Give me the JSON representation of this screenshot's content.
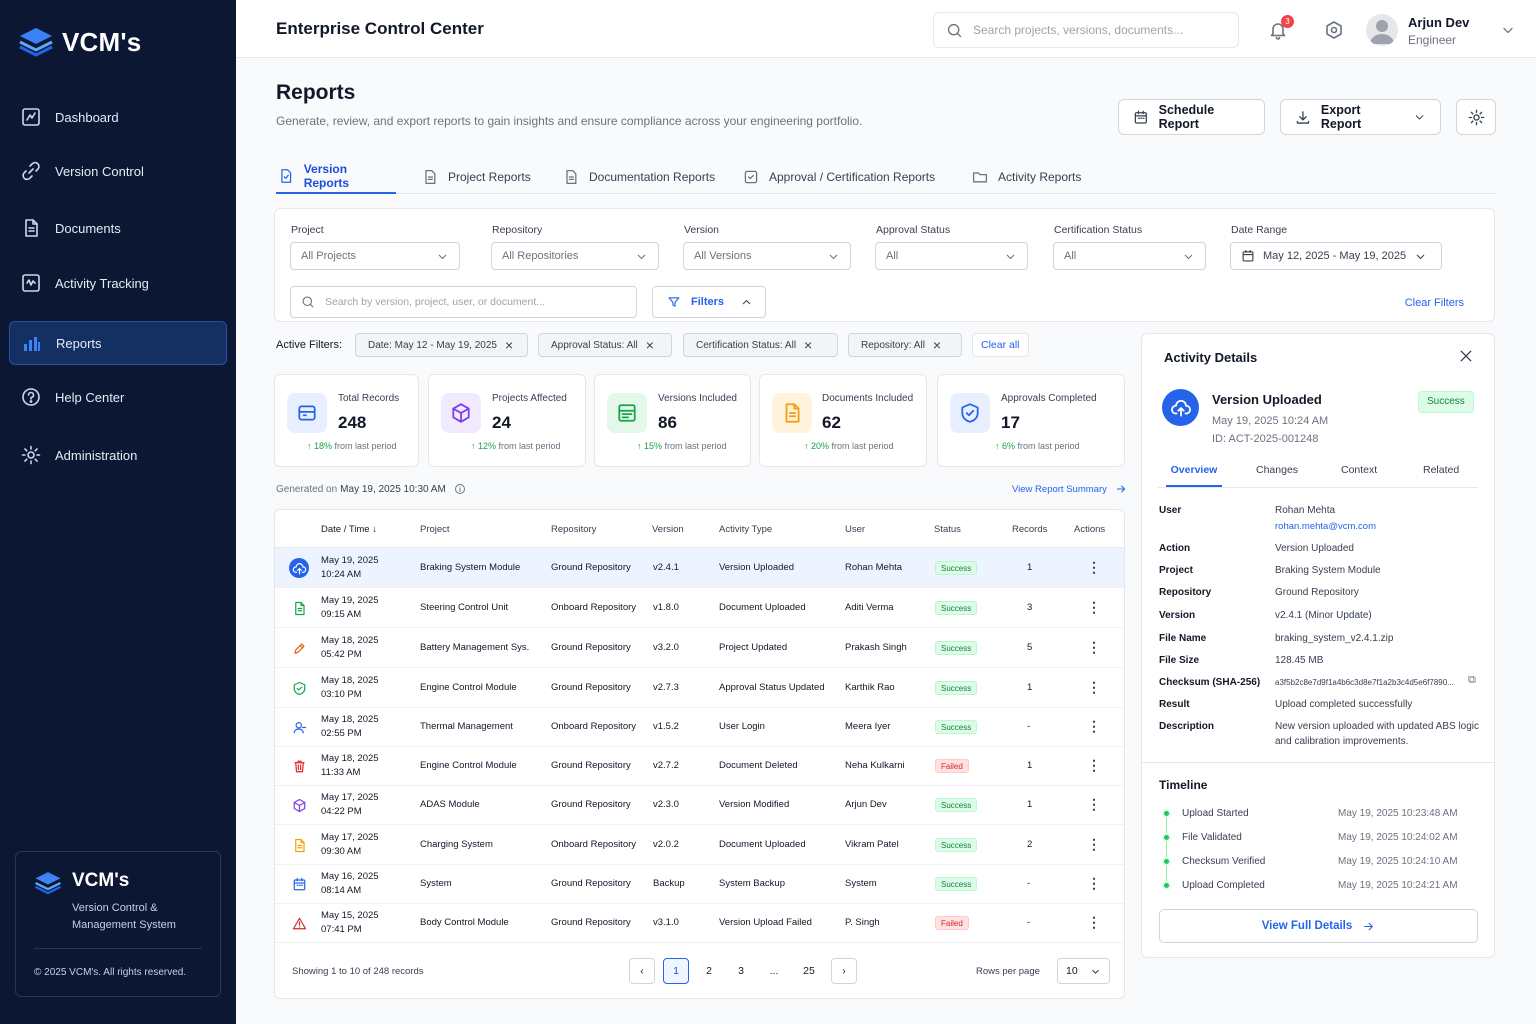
{
  "brand": {
    "logo_text": "VCM's",
    "card_title": "VCM's",
    "card_desc": "Version Control & Management System",
    "copyright": "© 2025 VCM's. All rights reserved."
  },
  "sidebar": {
    "items": [
      {
        "label": "Dashboard",
        "icon": "dashboard-icon"
      },
      {
        "label": "Version Control",
        "icon": "link-icon"
      },
      {
        "label": "Documents",
        "icon": "document-icon"
      },
      {
        "label": "Activity Tracking",
        "icon": "activity-icon"
      },
      {
        "label": "Reports",
        "icon": "bar-chart-icon",
        "active": true
      },
      {
        "label": "Help Center",
        "icon": "help-icon"
      },
      {
        "label": "Administration",
        "icon": "gear-icon"
      }
    ]
  },
  "header": {
    "title": "Enterprise Control Center",
    "search_placeholder": "Search projects, versions, documents...",
    "notif_count": "3",
    "user_name": "Arjun Dev",
    "user_role": "Engineer"
  },
  "page": {
    "title": "Reports",
    "subtitle": "Generate, review, and export reports to gain insights and ensure compliance across your engineering portfolio.",
    "schedule_label": "Schedule Report",
    "export_label": "Export Report"
  },
  "tabs": [
    "Version Reports",
    "Project Reports",
    "Documentation Reports",
    "Approval / Certification Reports",
    "Activity Reports"
  ],
  "filters": {
    "project": {
      "label": "Project",
      "value": "All Projects"
    },
    "repository": {
      "label": "Repository",
      "value": "All Repositories"
    },
    "version": {
      "label": "Version",
      "value": "All Versions"
    },
    "approval": {
      "label": "Approval Status",
      "value": "All"
    },
    "certification": {
      "label": "Certification Status",
      "value": "All"
    },
    "date": {
      "label": "Date Range",
      "value": "May 12, 2025 - May 19, 2025"
    },
    "search_placeholder": "Search by version, project, user, or document...",
    "filters_label": "Filters",
    "clear_label": "Clear Filters"
  },
  "active_filters": {
    "label": "Active Filters:",
    "chips": [
      "Date: May 12 - May 19, 2025",
      "Approval Status: All",
      "Certification Status: All",
      "Repository: All"
    ],
    "clear_all": "Clear all"
  },
  "stats": [
    {
      "label": "Total Records",
      "value": "248",
      "trend": "↑ 18%",
      "trend_text": "from last period",
      "color": "#2563eb",
      "bg": "#e8efff"
    },
    {
      "label": "Projects Affected",
      "value": "24",
      "trend": "↑ 12%",
      "trend_text": "from last period",
      "color": "#7c3aed",
      "bg": "#f1eafe"
    },
    {
      "label": "Versions Included",
      "value": "86",
      "trend": "↑ 15%",
      "trend_text": "from last period",
      "color": "#16a34a",
      "bg": "#e3f7ea"
    },
    {
      "label": "Documents Included",
      "value": "62",
      "trend": "↑ 20%",
      "trend_text": "from last period",
      "color": "#f59e0b",
      "bg": "#fff3dc"
    },
    {
      "label": "Approvals Completed",
      "value": "17",
      "trend": "↑ 6%",
      "trend_text": "from last period",
      "color": "#2563eb",
      "bg": "#e8efff"
    }
  ],
  "generated": {
    "prefix": "Generated on",
    "value": "May 19, 2025 10:30 AM",
    "summary_link": "View Report Summary"
  },
  "table": {
    "columns": [
      "Date / Time",
      "Project",
      "Repository",
      "Version",
      "Activity Type",
      "User",
      "Status",
      "Records",
      "Actions"
    ],
    "rows": [
      {
        "date": "May 19, 2025",
        "time": "10:24 AM",
        "project": "Braking System Module",
        "repo": "Ground Repository",
        "version": "v2.4.1",
        "activity": "Version Uploaded",
        "user": "Rohan Mehta",
        "status": "Success",
        "records": "1",
        "icon": "upload-cloud-icon",
        "color": "#2563eb"
      },
      {
        "date": "May 19, 2025",
        "time": "09:15 AM",
        "project": "Steering Control Unit",
        "repo": "Onboard Repository",
        "version": "v1.8.0",
        "activity": "Document Uploaded",
        "user": "Aditi Verma",
        "status": "Success",
        "records": "3",
        "icon": "document-icon",
        "color": "#16a34a"
      },
      {
        "date": "May 18, 2025",
        "time": "05:42 PM",
        "project": "Battery Management Sys.",
        "repo": "Ground Repository",
        "version": "v3.2.0",
        "activity": "Project Updated",
        "user": "Prakash Singh",
        "status": "Success",
        "records": "5",
        "icon": "pencil-icon",
        "color": "#ea580c"
      },
      {
        "date": "May 18, 2025",
        "time": "03:10 PM",
        "project": "Engine Control Module",
        "repo": "Ground Repository",
        "version": "v2.7.3",
        "activity": "Approval Status Updated",
        "user": "Karthik Rao",
        "status": "Success",
        "records": "1",
        "icon": "shield-check-icon",
        "color": "#16a34a"
      },
      {
        "date": "May 18, 2025",
        "time": "02:55 PM",
        "project": "Thermal Management",
        "repo": "Onboard Repository",
        "version": "v1.5.2",
        "activity": "User Login",
        "user": "Meera Iyer",
        "status": "Success",
        "records": "-",
        "icon": "user-icon",
        "color": "#2563eb"
      },
      {
        "date": "May 18, 2025",
        "time": "11:33 AM",
        "project": "Engine Control Module",
        "repo": "Ground Repository",
        "version": "v2.7.2",
        "activity": "Document Deleted",
        "user": "Neha Kulkarni",
        "status": "Failed",
        "records": "1",
        "icon": "trash-icon",
        "color": "#dc2626"
      },
      {
        "date": "May 17, 2025",
        "time": "04:22 PM",
        "project": "ADAS Module",
        "repo": "Ground Repository",
        "version": "v2.3.0",
        "activity": "Version Modified",
        "user": "Arjun Dev",
        "status": "Success",
        "records": "1",
        "icon": "cube-icon",
        "color": "#7c3aed"
      },
      {
        "date": "May 17, 2025",
        "time": "09:30 AM",
        "project": "Charging System",
        "repo": "Onboard Repository",
        "version": "v2.0.2",
        "activity": "Document Uploaded",
        "user": "Vikram Patel",
        "status": "Success",
        "records": "2",
        "icon": "document-icon",
        "color": "#f59e0b"
      },
      {
        "date": "May 16, 2025",
        "time": "08:14 AM",
        "project": "System",
        "repo": "Ground Repository",
        "version": "Backup",
        "activity": "System Backup",
        "user": "System",
        "status": "Success",
        "records": "-",
        "icon": "calendar-icon",
        "color": "#2563eb"
      },
      {
        "date": "May 15, 2025",
        "time": "07:41 PM",
        "project": "Body Control Module",
        "repo": "Ground Repository",
        "version": "v3.1.0",
        "activity": "Version Upload Failed",
        "user": "P. Singh",
        "status": "Failed",
        "records": "-",
        "icon": "warning-icon",
        "color": "#dc2626"
      }
    ],
    "showing": "Showing 1 to 10 of 248 records",
    "pages": [
      "1",
      "2",
      "3",
      "...",
      "25"
    ],
    "rows_per_page_label": "Rows per page",
    "rows_per_page": "10"
  },
  "details": {
    "title": "Activity Details",
    "event": "Version Uploaded",
    "event_date": "May 19, 2025 10:24 AM",
    "event_id": "ID: ACT-2025-001248",
    "status": "Success",
    "tabs": [
      "Overview",
      "Changes",
      "Context",
      "Related"
    ],
    "user": {
      "label": "User",
      "name": "Rohan Mehta",
      "email": "rohan.mehta@vcm.com"
    },
    "fields": [
      {
        "k": "Action",
        "v": "Version Uploaded"
      },
      {
        "k": "Project",
        "v": "Braking System Module"
      },
      {
        "k": "Repository",
        "v": "Ground Repository"
      },
      {
        "k": "Version",
        "v": "v2.4.1 (Minor Update)"
      },
      {
        "k": "File Name",
        "v": "braking_system_v2.4.1.zip"
      },
      {
        "k": "File Size",
        "v": "128.45 MB"
      },
      {
        "k": "Checksum (SHA-256)",
        "v": "a3f5b2c8e7d9f1a4b6c3d8e7f1a2b3c4d5e6f7890..."
      },
      {
        "k": "Result",
        "v": "Upload completed successfully"
      },
      {
        "k": "Description",
        "v": "New version uploaded with updated ABS logic and calibration improvements."
      }
    ],
    "timeline_title": "Timeline",
    "timeline": [
      {
        "label": "Upload Started",
        "time": "May 19, 2025 10:23:48 AM"
      },
      {
        "label": "File Validated",
        "time": "May 19, 2025 10:24:02 AM"
      },
      {
        "label": "Checksum Verified",
        "time": "May 19, 2025 10:24:10 AM"
      },
      {
        "label": "Upload Completed",
        "time": "May 19, 2025 10:24:21 AM"
      }
    ],
    "view_full": "View Full Details"
  }
}
